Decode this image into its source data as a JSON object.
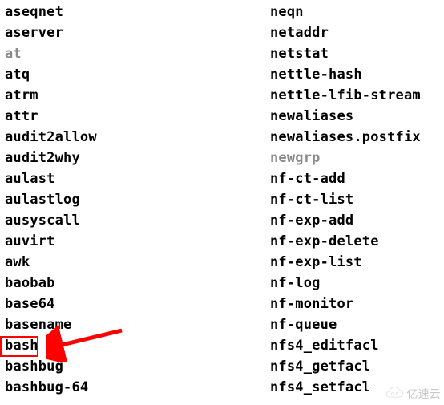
{
  "left_column": [
    {
      "label": "aseqnet",
      "muted": false
    },
    {
      "label": "aserver",
      "muted": false
    },
    {
      "label": "at",
      "muted": true
    },
    {
      "label": "atq",
      "muted": false
    },
    {
      "label": "atrm",
      "muted": false
    },
    {
      "label": "attr",
      "muted": false
    },
    {
      "label": "audit2allow",
      "muted": false
    },
    {
      "label": "audit2why",
      "muted": false
    },
    {
      "label": "aulast",
      "muted": false
    },
    {
      "label": "aulastlog",
      "muted": false
    },
    {
      "label": "ausyscall",
      "muted": false
    },
    {
      "label": "auvirt",
      "muted": false
    },
    {
      "label": "awk",
      "muted": false
    },
    {
      "label": "baobab",
      "muted": false
    },
    {
      "label": "base64",
      "muted": false
    },
    {
      "label": "basename",
      "muted": false
    },
    {
      "label": "bash",
      "muted": false,
      "highlighted": true
    },
    {
      "label": "bashbug",
      "muted": false
    },
    {
      "label": "bashbug-64",
      "muted": false
    }
  ],
  "right_column": [
    {
      "label": "neqn",
      "muted": false
    },
    {
      "label": "netaddr",
      "muted": false
    },
    {
      "label": "netstat",
      "muted": false
    },
    {
      "label": "nettle-hash",
      "muted": false
    },
    {
      "label": "nettle-lfib-stream",
      "muted": false
    },
    {
      "label": "newaliases",
      "muted": false
    },
    {
      "label": "newaliases.postfix",
      "muted": false
    },
    {
      "label": "newgrp",
      "muted": true
    },
    {
      "label": "nf-ct-add",
      "muted": false
    },
    {
      "label": "nf-ct-list",
      "muted": false
    },
    {
      "label": "nf-exp-add",
      "muted": false
    },
    {
      "label": "nf-exp-delete",
      "muted": false
    },
    {
      "label": "nf-exp-list",
      "muted": false
    },
    {
      "label": "nf-log",
      "muted": false
    },
    {
      "label": "nf-monitor",
      "muted": false
    },
    {
      "label": "nf-queue",
      "muted": false
    },
    {
      "label": "nfs4_editfacl",
      "muted": false
    },
    {
      "label": "nfs4_getfacl",
      "muted": false
    },
    {
      "label": "nfs4_setfacl",
      "muted": false
    }
  ],
  "watermark": {
    "text": "亿速云"
  }
}
